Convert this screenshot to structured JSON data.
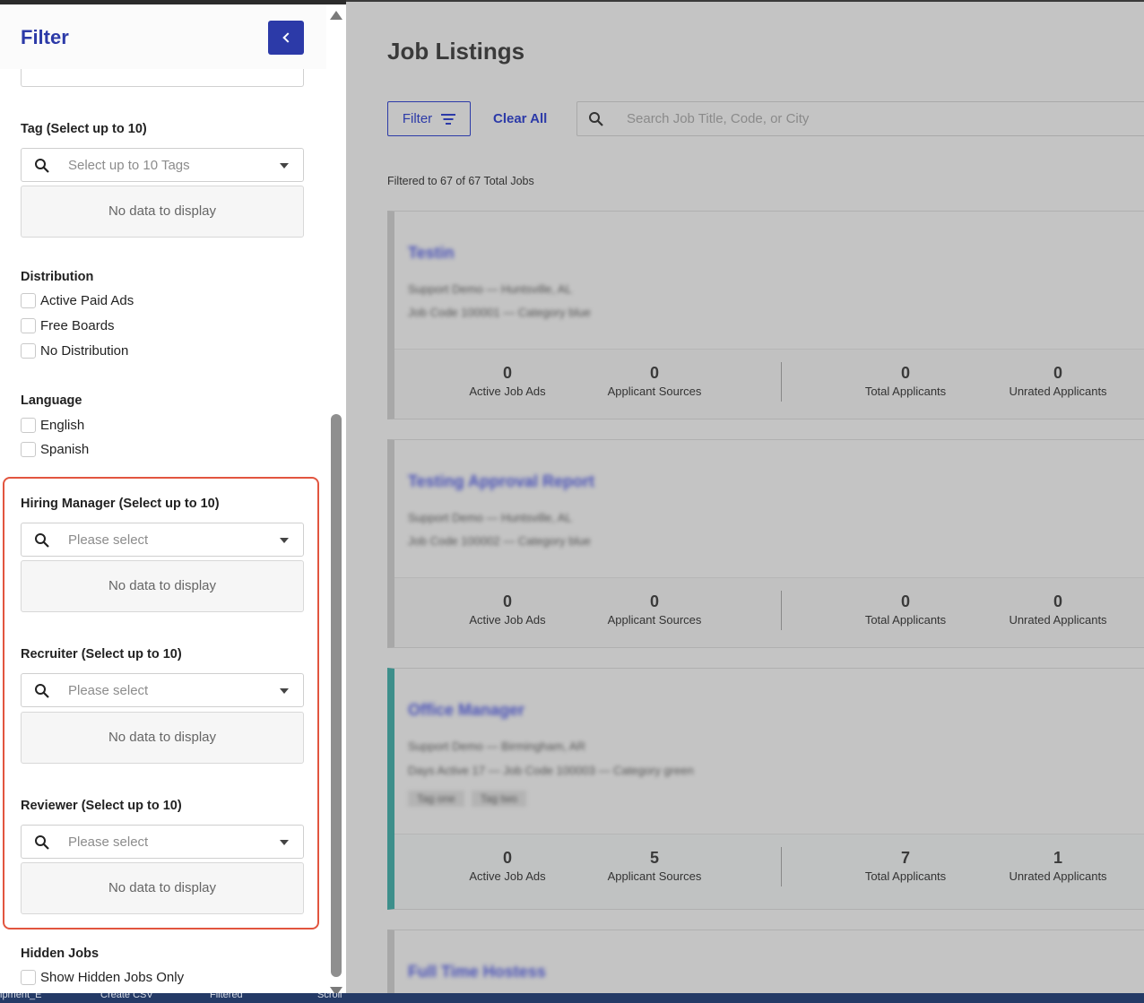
{
  "main": {
    "title": "Job Listings",
    "filter_button": "Filter",
    "clear_all": "Clear All",
    "search_placeholder": "Search Job Title, Code, or City",
    "filtered_count": "Filtered to 67 of 67 Total Jobs",
    "stat_labels": {
      "active_job_ads": "Active Job Ads",
      "applicant_sources": "Applicant Sources",
      "total_applicants": "Total Applicants",
      "unrated_applicants": "Unrated Applicants"
    },
    "jobs": [
      {
        "title": "Testin",
        "location": "Support Demo — Huntsville, AL",
        "details": "Job Code 100001 — Category blue",
        "active_job_ads": "0",
        "applicant_sources": "0",
        "total_applicants": "0",
        "unrated_applicants": "0"
      },
      {
        "title": "Testing Approval Report",
        "location": "Support Demo — Huntsville, AL",
        "details": "Job Code 100002 — Category blue",
        "active_job_ads": "0",
        "applicant_sources": "0",
        "total_applicants": "0",
        "unrated_applicants": "0"
      },
      {
        "title": "Office Manager",
        "location": "Support Demo — Birmingham, AR",
        "details": "Days Active 17 — Job Code 100003 — Category green",
        "tags": [
          "Tag one",
          "Tag two"
        ],
        "active_job_ads": "0",
        "applicant_sources": "5",
        "total_applicants": "7",
        "unrated_applicants": "1"
      },
      {
        "title": "Full Time Hostess"
      }
    ]
  },
  "filter_panel": {
    "title": "Filter",
    "tag": {
      "label": "Tag (Select up to 10)",
      "placeholder": "Select up to 10 Tags",
      "empty": "No data to display"
    },
    "distribution": {
      "label": "Distribution",
      "options": [
        "Active Paid Ads",
        "Free Boards",
        "No Distribution"
      ]
    },
    "language": {
      "label": "Language",
      "options": [
        "English",
        "Spanish"
      ]
    },
    "hiring_manager": {
      "label": "Hiring Manager (Select up to 10)",
      "placeholder": "Please select",
      "empty": "No data to display"
    },
    "recruiter": {
      "label": "Recruiter (Select up to 10)",
      "placeholder": "Please select",
      "empty": "No data to display"
    },
    "reviewer": {
      "label": "Reviewer (Select up to 10)",
      "placeholder": "Please select",
      "empty": "No data to display"
    },
    "hidden_jobs": {
      "label": "Hidden Jobs",
      "option": "Show Hidden Jobs Only"
    }
  },
  "taskbar": [
    "ipment_E",
    "Create CSV",
    "Filtered",
    "Scroll"
  ],
  "colors": {
    "accent": "#2c3aa8",
    "highlight": "#e2553f",
    "active_card": "#3d8f8b"
  },
  "icons": [
    "search-icon",
    "chevron-left-icon",
    "filter-icon",
    "caret-down-icon",
    "scroll-up-arrow-icon",
    "scroll-down-arrow-icon"
  ]
}
